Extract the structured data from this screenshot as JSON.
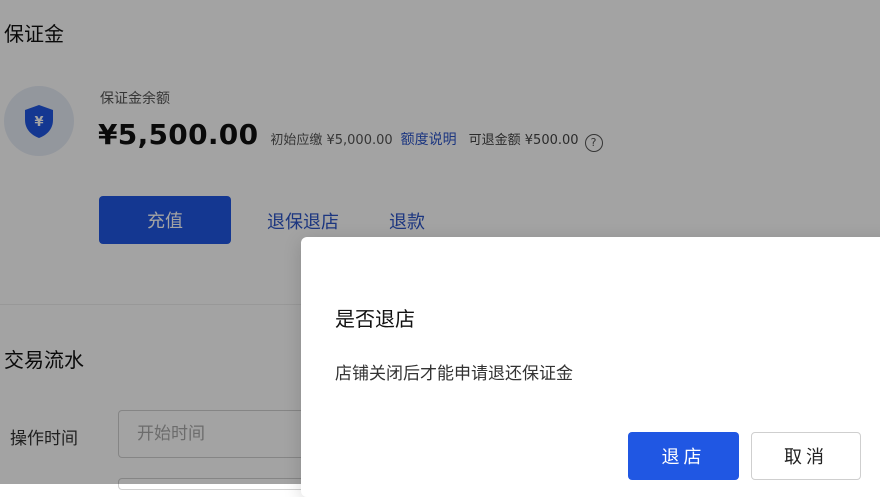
{
  "deposit": {
    "title": "保证金",
    "icon": "shield-yen-icon",
    "balance_label": "保证金余额",
    "balance_amount": "¥5,500.00",
    "initial_due": "初始应缴 ¥5,000.00",
    "quota_link": "额度说明",
    "refundable": "可退金额 ¥500.00",
    "help_icon_glyph": "?",
    "recharge_button": "充值",
    "withdraw_close_link": "退保退店",
    "refund_link": "退款"
  },
  "transactions": {
    "title": "交易流水",
    "op_time_label": "操作时间",
    "start_time_placeholder": "开始时间"
  },
  "dialog": {
    "title": "是否退店",
    "message": "店铺关闭后才能申请退还保证金",
    "confirm_button": "退店",
    "cancel_button": "取消"
  },
  "colors": {
    "primary": "#2057e3",
    "link": "#2c55c8",
    "icon_bg": "#e6ecf6",
    "mask": "rgba(0,0,0,0.36)"
  }
}
